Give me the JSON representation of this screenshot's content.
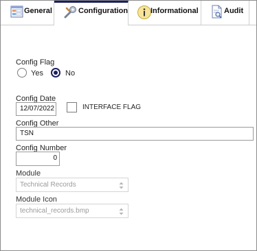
{
  "tabs": [
    {
      "label": "General",
      "icon": "form-icon",
      "active": false
    },
    {
      "label": "Configuration",
      "icon": "wrench-icon",
      "active": true
    },
    {
      "label": "Informational",
      "icon": "info-icon",
      "active": false
    },
    {
      "label": "Audit",
      "icon": "document-magnifier-icon",
      "active": false
    }
  ],
  "config_flag": {
    "label": "Config Flag",
    "options": [
      {
        "label": "Yes",
        "selected": false
      },
      {
        "label": "No",
        "selected": true
      }
    ]
  },
  "config_date": {
    "label": "Config Date",
    "value": "12/07/2022"
  },
  "interface_flag": {
    "label": "INTERFACE FLAG",
    "checked": false
  },
  "config_other": {
    "label": "Config Other",
    "value": "TSN"
  },
  "config_number": {
    "label": "Config Number",
    "value": "0"
  },
  "module": {
    "label": "Module",
    "value": "Technical Records",
    "disabled": true
  },
  "module_icon": {
    "label": "Module Icon",
    "value": "technical_records.bmp",
    "disabled": true
  },
  "colors": {
    "accent": "#1a1f5e",
    "border": "#9a9a9a",
    "disabled_text": "#9a9a9a"
  }
}
